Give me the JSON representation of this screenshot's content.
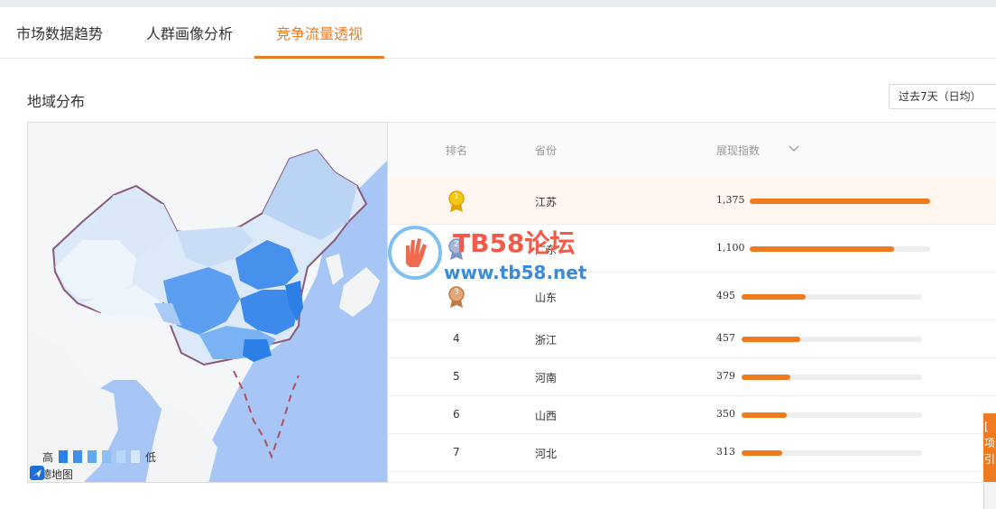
{
  "tabs": [
    {
      "label": "市场数据趋势",
      "active": false
    },
    {
      "label": "人群画像分析",
      "active": false
    },
    {
      "label": "竞争流量透视",
      "active": true
    }
  ],
  "section": {
    "title": "地域分布",
    "range_select": "过去7天（日均）"
  },
  "map": {
    "legend_high": "高",
    "legend_low": "低",
    "legend_colors": [
      "#2b82e8",
      "#3f90ec",
      "#62a8f1",
      "#8cc0f5",
      "#b7d8f9",
      "#d6e8fb"
    ],
    "provider": "高德地图",
    "icons": [
      "amap-logo-icon"
    ]
  },
  "table": {
    "headers": {
      "rank": "排名",
      "province": "省份",
      "index": "展现指数"
    },
    "sort_icon": "chevron-down-icon",
    "max": 1375,
    "rows": [
      {
        "rank": "1",
        "province": "江苏",
        "value": "1,375",
        "num": 1375,
        "medal": "gold"
      },
      {
        "rank": "2",
        "province": "广东",
        "value": "1,100",
        "num": 1100,
        "medal": "silver"
      },
      {
        "rank": "3",
        "province": "山东",
        "value": "495",
        "num": 495,
        "medal": "bronze"
      },
      {
        "rank": "4",
        "province": "浙江",
        "value": "457",
        "num": 457,
        "medal": ""
      },
      {
        "rank": "5",
        "province": "河南",
        "value": "379",
        "num": 379,
        "medal": ""
      },
      {
        "rank": "6",
        "province": "山西",
        "value": "350",
        "num": 350,
        "medal": ""
      },
      {
        "rank": "7",
        "province": "河北",
        "value": "313",
        "num": 313,
        "medal": ""
      }
    ]
  },
  "watermark": {
    "title": "TB58论坛",
    "url": "www.tb58.net"
  },
  "side_tab": {
    "label": "[ 项 引"
  }
}
